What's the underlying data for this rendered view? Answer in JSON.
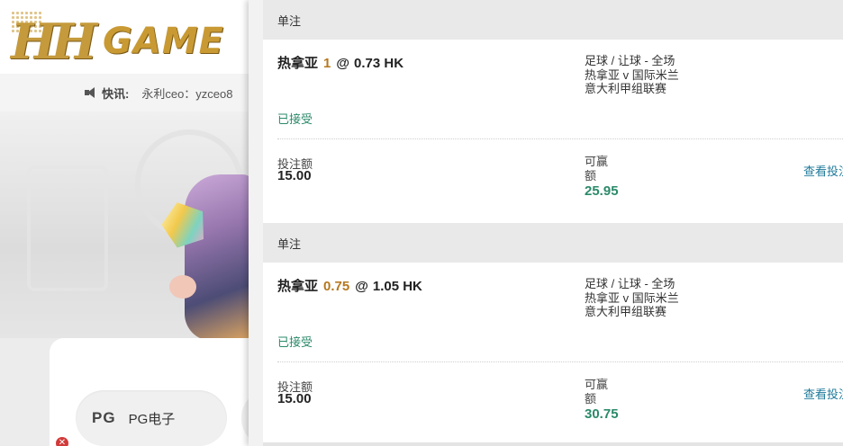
{
  "background_site": {
    "logo_text": "HH GAME",
    "news_label": "快讯:",
    "news_text": "永利ceo：yzceo8",
    "category_label": "PG电子",
    "category_logo": "PG"
  },
  "bets": [
    {
      "header": "单注",
      "selection": "热拿亚",
      "line": "1",
      "at": "@",
      "odds": "0.73 HK",
      "market": [
        "足球 / 让球 - 全场",
        "热拿亚 v 国际米兰",
        "意大利甲组联赛"
      ],
      "status": "已接受",
      "stake_label": "投注额",
      "stake": "15.00",
      "win_label": "可赢额",
      "win": "25.95",
      "view_link": "查看投注"
    },
    {
      "header": "单注",
      "selection": "热拿亚",
      "line": "0.75",
      "at": "@",
      "odds": "1.05 HK",
      "market": [
        "足球 / 让球 - 全场",
        "热拿亚 v 国际米兰",
        "意大利甲组联赛"
      ],
      "status": "已接受",
      "stake_label": "投注额",
      "stake": "15.00",
      "win_label": "可赢额",
      "win": "30.75",
      "view_link": "查看投注"
    }
  ],
  "colors": {
    "accepted": "#2b8a6a",
    "line_highlight": "#b5781f",
    "link": "#1f7a9a",
    "logo_gold": "#c99a33"
  }
}
